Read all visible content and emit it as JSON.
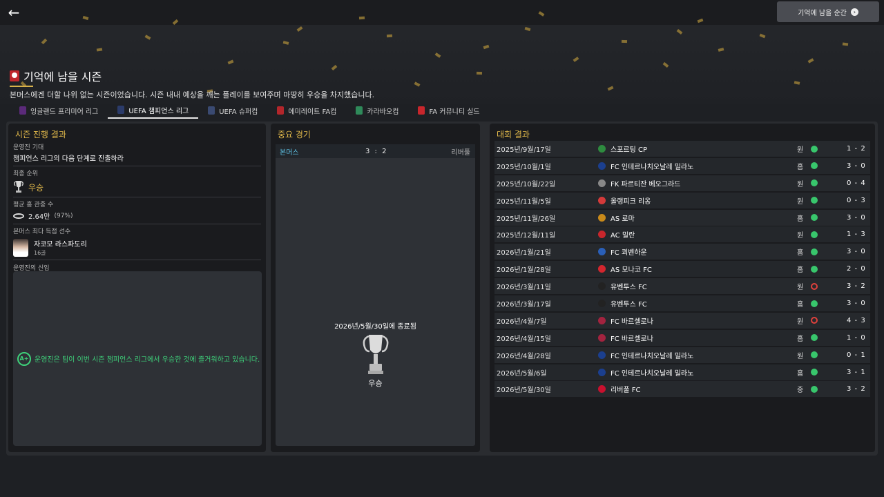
{
  "header": {
    "back_icon": "arrow-left-icon",
    "moments_button": "기억에 남을 순간"
  },
  "page": {
    "title": "기억에 남을 시즌",
    "subtitle": "본머스에겐 더할 나위 없는 시즌이었습니다. 시즌 내내 예상을 깨는 플레이를 보여주며 마땅히 우승을 차지했습니다."
  },
  "tabs": [
    {
      "label": "잉글랜드 프리미어 리그",
      "color": "#5b2a7a"
    },
    {
      "label": "UEFA 챔피언스 리그",
      "color": "#2b3b6a"
    },
    {
      "label": "UEFA 슈퍼컵",
      "color": "#3a4a72"
    },
    {
      "label": "에미레이트 FA컵",
      "color": "#b3262b"
    },
    {
      "label": "카라바오컵",
      "color": "#2f8a5a"
    },
    {
      "label": "FA 커뮤니티 실드",
      "color": "#c8262c"
    }
  ],
  "season": {
    "title": "시즌 진행 결과",
    "board_label": "운영진 기대",
    "board_value": "챔피언스 리그의 다음 단계로 진출하라",
    "rank_label": "최종 순위",
    "rank_value": "우승",
    "attendance_label": "평균 홈 관중 수",
    "attendance_value": "2.64만",
    "attendance_pct": "(97%)",
    "scorer_label": "본머스 최다 득점 선수",
    "scorer_name": "자코모 라스파도리",
    "scorer_goals": "16골",
    "confidence_label": "운영진의 신임",
    "confidence_grade": "A+",
    "confidence_text": "운영진은 팀이 이번 시즌 챔피언스 리그에서 우승한 것에 즐거워하고 있습니다."
  },
  "key_match": {
    "title": "중요 경기",
    "home": "본머스",
    "score": "3 : 2",
    "away": "리버풀",
    "final_text": "2026년/5월/30일에 종료됨",
    "result": "우승"
  },
  "results": {
    "title": "대회 결과",
    "rows": [
      {
        "date": "2025년/9월/17일",
        "opponent": "스포르팅 CP",
        "venue": "원",
        "outcome": "win",
        "score": "1 - 2",
        "crest": "#2e8b3f"
      },
      {
        "date": "2025년/10월/1일",
        "opponent": "FC 인테르나치오날레 밀라노",
        "venue": "홈",
        "outcome": "win",
        "score": "3 - 0",
        "crest": "#1b3f8f"
      },
      {
        "date": "2025년/10월/22일",
        "opponent": "FK 파르티잔 베오그라드",
        "venue": "원",
        "outcome": "win",
        "score": "0 - 4",
        "crest": "#888888"
      },
      {
        "date": "2025년/11월/5일",
        "opponent": "올랭피크 리옹",
        "venue": "원",
        "outcome": "win",
        "score": "0 - 3",
        "crest": "#d43a3a"
      },
      {
        "date": "2025년/11월/26일",
        "opponent": "AS 로마",
        "venue": "홈",
        "outcome": "win",
        "score": "3 - 0",
        "crest": "#c98a1a"
      },
      {
        "date": "2025년/12월/11일",
        "opponent": "AC 밀란",
        "venue": "원",
        "outcome": "win",
        "score": "1 - 3",
        "crest": "#c8262c"
      },
      {
        "date": "2026년/1월/21일",
        "opponent": "FC 쾨벤하운",
        "venue": "홈",
        "outcome": "win",
        "score": "3 - 0",
        "crest": "#2a5fb8"
      },
      {
        "date": "2026년/1월/28일",
        "opponent": "AS 모나코 FC",
        "venue": "홈",
        "outcome": "win",
        "score": "2 - 0",
        "crest": "#d4262e"
      },
      {
        "date": "2026년/3월/11일",
        "opponent": "유벤투스 FC",
        "venue": "원",
        "outcome": "draw",
        "score": "3 - 2",
        "crest": "#222222"
      },
      {
        "date": "2026년/3월/17일",
        "opponent": "유벤투스 FC",
        "venue": "홈",
        "outcome": "win",
        "score": "3 - 0",
        "crest": "#222222"
      },
      {
        "date": "2026년/4월/7일",
        "opponent": "FC 바르셀로나",
        "venue": "원",
        "outcome": "draw",
        "score": "4 - 3",
        "crest": "#a3233f"
      },
      {
        "date": "2026년/4월/15일",
        "opponent": "FC 바르셀로나",
        "venue": "홈",
        "outcome": "win",
        "score": "1 - 0",
        "crest": "#a3233f"
      },
      {
        "date": "2026년/4월/28일",
        "opponent": "FC 인테르나치오날레 밀라노",
        "venue": "원",
        "outcome": "win",
        "score": "0 - 1",
        "crest": "#1b3f8f"
      },
      {
        "date": "2026년/5월/6일",
        "opponent": "FC 인테르나치오날레 밀라노",
        "venue": "홈",
        "outcome": "win",
        "score": "3 - 1",
        "crest": "#1b3f8f"
      },
      {
        "date": "2026년/5월/30일",
        "opponent": "리버풀 FC",
        "venue": "중",
        "outcome": "win",
        "score": "3 - 2",
        "crest": "#c8102e"
      }
    ]
  }
}
